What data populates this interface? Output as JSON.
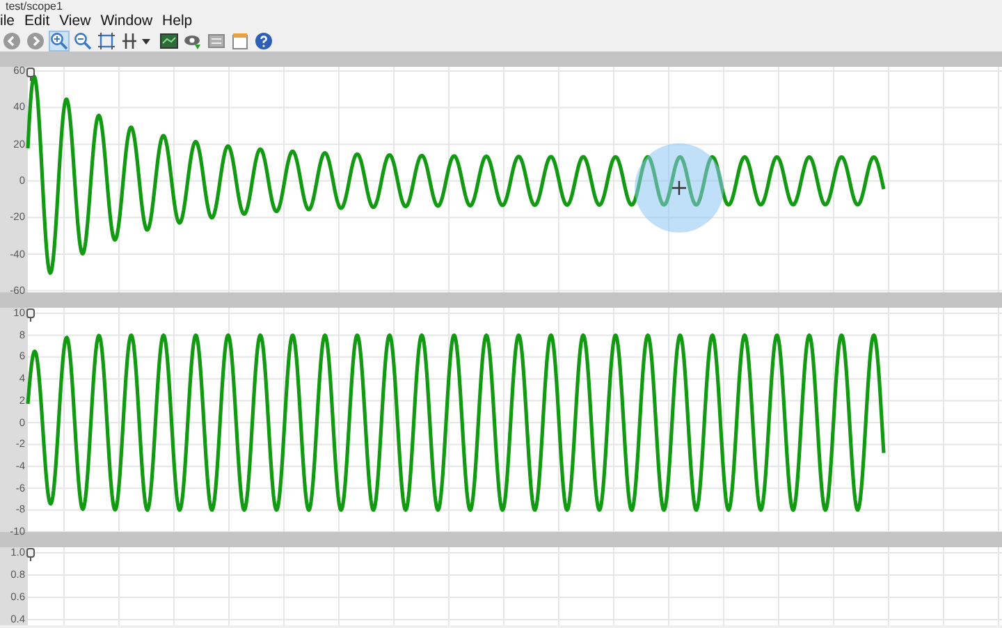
{
  "window": {
    "title": "test/scope1"
  },
  "menu": [
    "ile",
    "Edit",
    "View",
    "Window",
    "Help"
  ],
  "toolbar": [
    {
      "kind": "back",
      "selected": false
    },
    {
      "kind": "forward",
      "selected": false
    },
    {
      "kind": "zoom-in",
      "selected": true
    },
    {
      "kind": "zoom-out",
      "selected": false
    },
    {
      "kind": "zoom-fit",
      "selected": false
    },
    {
      "kind": "cursor",
      "selected": false
    },
    {
      "kind": "monitor",
      "selected": false
    },
    {
      "kind": "highlight",
      "selected": false
    },
    {
      "kind": "display",
      "selected": false
    },
    {
      "kind": "notes",
      "selected": false
    },
    {
      "kind": "help",
      "selected": false
    }
  ],
  "plots": [
    {
      "kind": "decaying",
      "yticks": [
        "60",
        "40",
        "20",
        "0",
        "-20",
        "-40",
        "-60"
      ]
    },
    {
      "kind": "steady",
      "yticks": [
        "10",
        "8",
        "6",
        "4",
        "2",
        "0",
        "-2",
        "-4",
        "-6",
        "-8",
        "-10"
      ]
    },
    {
      "kind": "empty",
      "yticks": [
        "1.0",
        "0.8",
        "0.6",
        "0.4"
      ]
    }
  ],
  "cursor_highlight": true
}
